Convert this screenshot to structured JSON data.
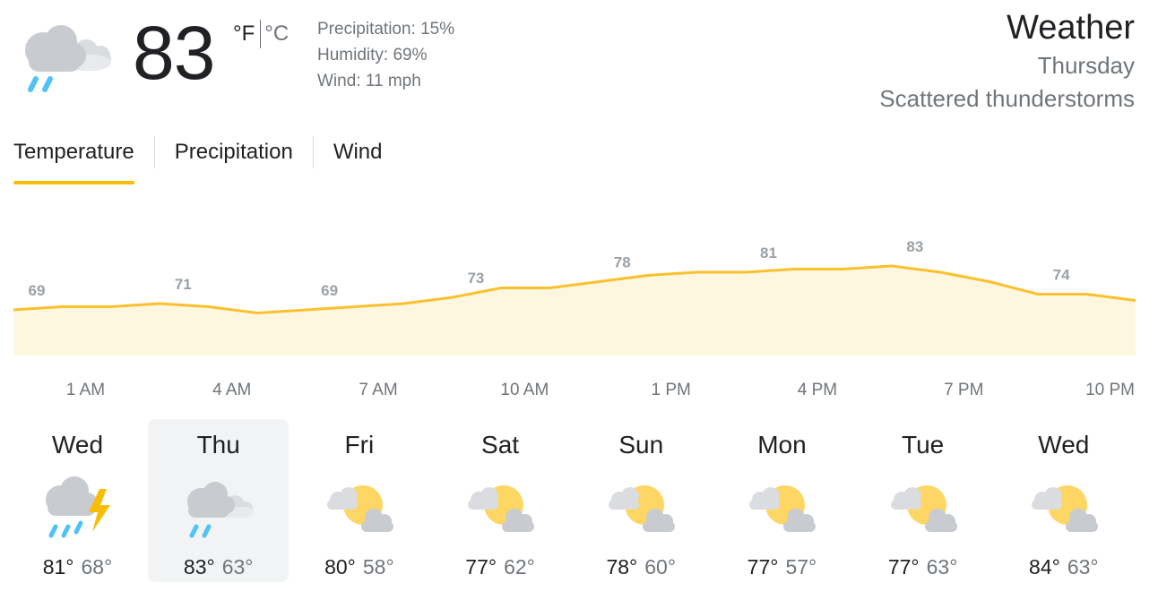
{
  "current": {
    "temperature": "83",
    "unit_f": "°F",
    "unit_c": "°C",
    "icon": "rain-cloud-icon",
    "precipitation": "Precipitation: 15%",
    "humidity": "Humidity: 69%",
    "wind": "Wind: 11 mph"
  },
  "summary": {
    "title": "Weather",
    "day": "Thursday",
    "condition": "Scattered thunderstorms"
  },
  "tabs": [
    {
      "label": "Temperature",
      "active": true
    },
    {
      "label": "Precipitation",
      "active": false
    },
    {
      "label": "Wind",
      "active": false
    }
  ],
  "colors": {
    "accent": "#fbbc04",
    "line": "#fbc02d",
    "fill": "#fef7e0",
    "sun": "#fdd663",
    "cloud": "#dadce0",
    "rain": "#4fc3f7",
    "lightning": "#fbbc04"
  },
  "chart_data": {
    "type": "area",
    "x": [
      "12 AM",
      "1 AM",
      "2 AM",
      "3 AM",
      "4 AM",
      "5 AM",
      "6 AM",
      "7 AM",
      "8 AM",
      "9 AM",
      "10 AM",
      "11 AM",
      "12 PM",
      "1 PM",
      "2 PM",
      "3 PM",
      "4 PM",
      "5 PM",
      "6 PM",
      "7 PM",
      "8 PM",
      "9 PM",
      "10 PM",
      "11 PM"
    ],
    "values": [
      69,
      70,
      70,
      71,
      70,
      68,
      69,
      70,
      71,
      73,
      76,
      76,
      78,
      80,
      81,
      81,
      82,
      82,
      83,
      81,
      78,
      74,
      74,
      72
    ],
    "labels": [
      {
        "index": 0,
        "text": "69"
      },
      {
        "index": 3,
        "text": "71"
      },
      {
        "index": 6,
        "text": "69"
      },
      {
        "index": 9,
        "text": "73"
      },
      {
        "index": 12,
        "text": "78"
      },
      {
        "index": 15,
        "text": "81"
      },
      {
        "index": 18,
        "text": "83"
      },
      {
        "index": 21,
        "text": "74"
      }
    ],
    "tick_labels": [
      {
        "index": 1,
        "text": "1 AM"
      },
      {
        "index": 4,
        "text": "4 AM"
      },
      {
        "index": 7,
        "text": "7 AM"
      },
      {
        "index": 10,
        "text": "10 AM"
      },
      {
        "index": 13,
        "text": "1 PM"
      },
      {
        "index": 16,
        "text": "4 PM"
      },
      {
        "index": 19,
        "text": "7 PM"
      },
      {
        "index": 22,
        "text": "10 PM"
      }
    ],
    "title": "",
    "xlabel": "",
    "ylabel": ""
  },
  "forecast": [
    {
      "day": "Wed",
      "high": "81°",
      "low": "68°",
      "icon": "thunderstorm-icon",
      "selected": false
    },
    {
      "day": "Thu",
      "high": "83°",
      "low": "63°",
      "icon": "rain-cloud-icon",
      "selected": true
    },
    {
      "day": "Fri",
      "high": "80°",
      "low": "58°",
      "icon": "partly-cloudy-icon",
      "selected": false
    },
    {
      "day": "Sat",
      "high": "77°",
      "low": "62°",
      "icon": "partly-cloudy-icon",
      "selected": false
    },
    {
      "day": "Sun",
      "high": "78°",
      "low": "60°",
      "icon": "partly-cloudy-icon",
      "selected": false
    },
    {
      "day": "Mon",
      "high": "77°",
      "low": "57°",
      "icon": "partly-cloudy-icon",
      "selected": false
    },
    {
      "day": "Tue",
      "high": "77°",
      "low": "63°",
      "icon": "partly-cloudy-icon",
      "selected": false
    },
    {
      "day": "Wed",
      "high": "84°",
      "low": "63°",
      "icon": "partly-cloudy-icon",
      "selected": false
    }
  ]
}
